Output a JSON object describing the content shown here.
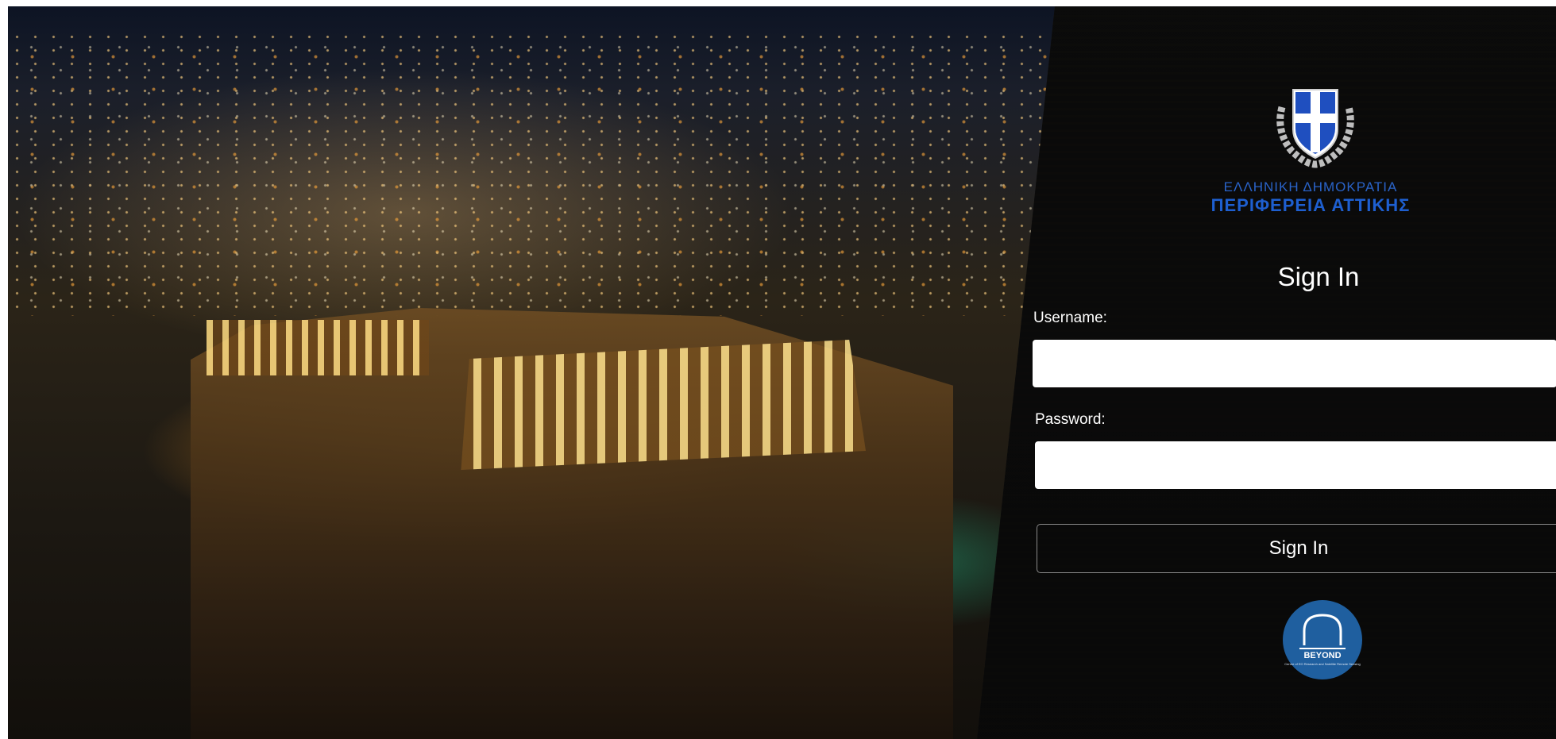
{
  "background": {
    "image_icon": "acropolis-night-photo"
  },
  "branding": {
    "emblem_icon": "hellenic-republic-emblem-icon",
    "org_line1": "ΕΛΛΗΝΙΚΗ ΔΗΜΟΚΡΑΤΙΑ",
    "org_line2": "ΠΕΡΙΦΕΡΕΙΑ ΑΤΤΙΚΗΣ",
    "accent": "#1e5fd0"
  },
  "form": {
    "title": "Sign In",
    "username_label": "Username:",
    "username_value": "",
    "password_label": "Password:",
    "password_value": "",
    "submit_label": "Sign In"
  },
  "footer": {
    "logo_icon": "beyond-logo-icon",
    "logo_text": "BEYOND",
    "logo_subtext": "Centre of EO Research and Satellite Remote Sensing"
  }
}
